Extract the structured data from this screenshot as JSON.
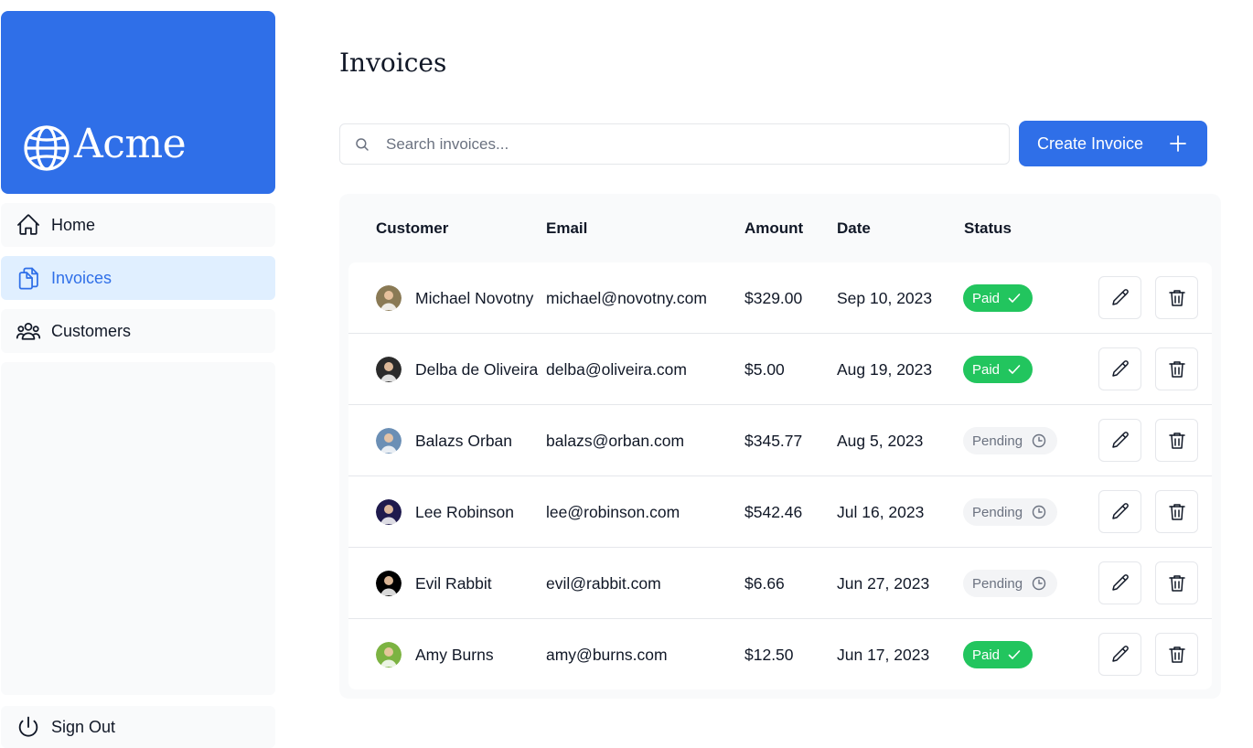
{
  "app": {
    "brand_name": "Acme"
  },
  "sidebar": {
    "items": [
      {
        "label": "Home",
        "icon": "home-icon",
        "active": false
      },
      {
        "label": "Invoices",
        "icon": "document-duplicate-icon",
        "active": true
      },
      {
        "label": "Customers",
        "icon": "user-group-icon",
        "active": false
      }
    ],
    "sign_out_label": "Sign Out"
  },
  "main": {
    "title": "Invoices",
    "search": {
      "placeholder": "Search invoices...",
      "value": ""
    },
    "create_button_label": "Create Invoice",
    "table": {
      "columns": [
        "Customer",
        "Email",
        "Amount",
        "Date",
        "Status"
      ],
      "rows": [
        {
          "customer": "Michael Novotny",
          "email": "michael@novotny.com",
          "amount": "$329.00",
          "date": "Sep 10, 2023",
          "status": "Paid",
          "avatar_color": "#8a7a55"
        },
        {
          "customer": "Delba de Oliveira",
          "email": "delba@oliveira.com",
          "amount": "$5.00",
          "date": "Aug 19, 2023",
          "status": "Paid",
          "avatar_color": "#2b2b2b"
        },
        {
          "customer": "Balazs Orban",
          "email": "balazs@orban.com",
          "amount": "$345.77",
          "date": "Aug 5, 2023",
          "status": "Pending",
          "avatar_color": "#6b8fb5"
        },
        {
          "customer": "Lee Robinson",
          "email": "lee@robinson.com",
          "amount": "$542.46",
          "date": "Jul 16, 2023",
          "status": "Pending",
          "avatar_color": "#1f1a4d"
        },
        {
          "customer": "Evil Rabbit",
          "email": "evil@rabbit.com",
          "amount": "$6.66",
          "date": "Jun 27, 2023",
          "status": "Pending",
          "avatar_color": "#000000"
        },
        {
          "customer": "Amy Burns",
          "email": "amy@burns.com",
          "amount": "$12.50",
          "date": "Jun 17, 2023",
          "status": "Paid",
          "avatar_color": "#7cb342"
        }
      ]
    }
  },
  "colors": {
    "accent": "#2f6fe8",
    "paid": "#22c55e",
    "pending_bg": "#f3f4f6",
    "active_nav_bg": "#e0efff"
  }
}
